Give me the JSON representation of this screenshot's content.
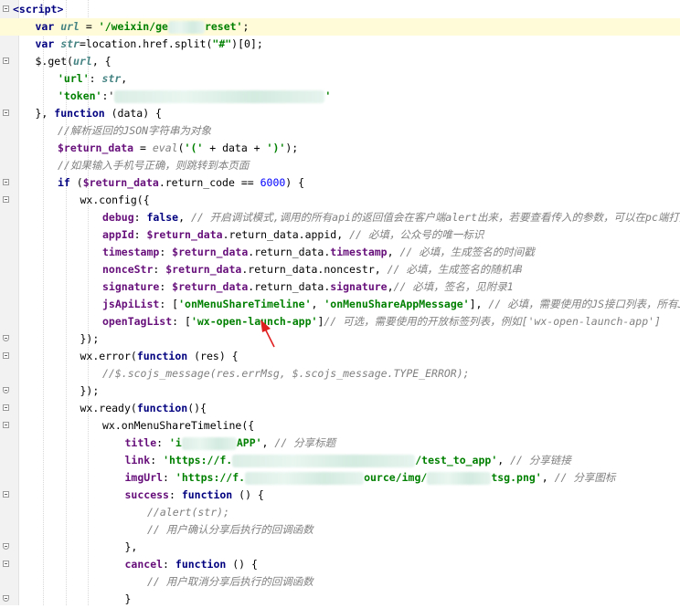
{
  "lines": [
    {
      "fold": "start",
      "hl": false,
      "indent": 0,
      "parts": [
        [
          "tag",
          "<script>"
        ]
      ]
    },
    {
      "fold": "",
      "hl": true,
      "indent": 1,
      "parts": [
        [
          "kw",
          "var "
        ],
        [
          "var",
          "url"
        ],
        [
          "plain",
          " = "
        ],
        [
          "str",
          "'/weixin/ge"
        ],
        [
          "blur",
          ""
        ],
        [
          "str",
          "reset'"
        ],
        [
          "plain",
          ";"
        ]
      ]
    },
    {
      "fold": "",
      "hl": false,
      "indent": 1,
      "parts": [
        [
          "kw",
          "var "
        ],
        [
          "var",
          "str"
        ],
        [
          "plain",
          "=location.href.split("
        ],
        [
          "str",
          "\"#\""
        ],
        [
          "plain",
          ")[0];"
        ]
      ]
    },
    {
      "fold": "start",
      "hl": false,
      "indent": 1,
      "parts": [
        [
          "plain",
          "$.get("
        ],
        [
          "var",
          "url"
        ],
        [
          "plain",
          ", {"
        ]
      ]
    },
    {
      "fold": "",
      "hl": false,
      "indent": 2,
      "parts": [
        [
          "str",
          "'url'"
        ],
        [
          "plain",
          ": "
        ],
        [
          "var",
          "str"
        ],
        [
          "plain",
          ","
        ]
      ]
    },
    {
      "fold": "",
      "hl": false,
      "indent": 2,
      "parts": [
        [
          "str",
          "'token'"
        ],
        [
          "plain",
          ":'"
        ],
        [
          "blur",
          ""
        ],
        [
          "str",
          "'"
        ]
      ]
    },
    {
      "fold": "start",
      "hl": false,
      "indent": 1,
      "parts": [
        [
          "plain",
          "}, "
        ],
        [
          "kw",
          "function "
        ],
        [
          "plain",
          "(data) {"
        ]
      ]
    },
    {
      "fold": "",
      "hl": false,
      "indent": 2,
      "parts": [
        [
          "cmt",
          "//解析返回的JSON字符串为对象"
        ]
      ]
    },
    {
      "fold": "",
      "hl": false,
      "indent": 2,
      "parts": [
        [
          "var2",
          "$return_data"
        ],
        [
          "plain",
          " = "
        ],
        [
          "cmt",
          "eval"
        ],
        [
          "plain",
          "("
        ],
        [
          "str",
          "'('"
        ],
        [
          "plain",
          " + data + "
        ],
        [
          "str",
          "')'"
        ],
        [
          "plain",
          ");"
        ]
      ]
    },
    {
      "fold": "",
      "hl": false,
      "indent": 2,
      "parts": [
        [
          "cmt",
          "//如果输入手机号正确，则跳转到本页面"
        ]
      ]
    },
    {
      "fold": "start",
      "hl": false,
      "indent": 2,
      "parts": [
        [
          "kw",
          "if "
        ],
        [
          "plain",
          "("
        ],
        [
          "var2",
          "$return_data"
        ],
        [
          "plain",
          ".return_code == "
        ],
        [
          "num",
          "6000"
        ],
        [
          "plain",
          ") {"
        ]
      ]
    },
    {
      "fold": "start",
      "hl": false,
      "indent": 3,
      "parts": [
        [
          "plain",
          "wx.config({"
        ]
      ]
    },
    {
      "fold": "",
      "hl": false,
      "indent": 4,
      "parts": [
        [
          "prop",
          "debug"
        ],
        [
          "plain",
          ": "
        ],
        [
          "kw",
          "false"
        ],
        [
          "plain",
          ", "
        ],
        [
          "cmt",
          "// 开启调试模式,调用的所有api的返回值会在客户端alert出来，若要查看传入的参数，可以在pc端打开"
        ]
      ]
    },
    {
      "fold": "",
      "hl": false,
      "indent": 4,
      "parts": [
        [
          "prop",
          "appId"
        ],
        [
          "plain",
          ": "
        ],
        [
          "var2",
          "$return_data"
        ],
        [
          "plain",
          ".return_data.appid, "
        ],
        [
          "cmt",
          "// 必填，公众号的唯一标识"
        ]
      ]
    },
    {
      "fold": "",
      "hl": false,
      "indent": 4,
      "parts": [
        [
          "prop",
          "timestamp"
        ],
        [
          "plain",
          ": "
        ],
        [
          "var2",
          "$return_data"
        ],
        [
          "plain",
          ".return_data."
        ],
        [
          "prop",
          "timestamp"
        ],
        [
          "plain",
          ", "
        ],
        [
          "cmt",
          "// 必填，生成签名的时间戳"
        ]
      ]
    },
    {
      "fold": "",
      "hl": false,
      "indent": 4,
      "parts": [
        [
          "prop",
          "nonceStr"
        ],
        [
          "plain",
          ": "
        ],
        [
          "var2",
          "$return_data"
        ],
        [
          "plain",
          ".return_data.noncestr, "
        ],
        [
          "cmt",
          "// 必填，生成签名的随机串"
        ]
      ]
    },
    {
      "fold": "",
      "hl": false,
      "indent": 4,
      "parts": [
        [
          "prop",
          "signature"
        ],
        [
          "plain",
          ": "
        ],
        [
          "var2",
          "$return_data"
        ],
        [
          "plain",
          ".return_data."
        ],
        [
          "prop",
          "signature"
        ],
        [
          "plain",
          ","
        ],
        [
          "cmt",
          "// 必填，签名，见附录1"
        ]
      ]
    },
    {
      "fold": "",
      "hl": false,
      "indent": 4,
      "parts": [
        [
          "prop",
          "jsApiList"
        ],
        [
          "plain",
          ": ["
        ],
        [
          "str",
          "'onMenuShareTimeline'"
        ],
        [
          "plain",
          ", "
        ],
        [
          "str",
          "'onMenuShareAppMessage'"
        ],
        [
          "plain",
          "], "
        ],
        [
          "cmt",
          "// 必填，需要使用的JS接口列表，所有JS"
        ]
      ]
    },
    {
      "fold": "",
      "hl": false,
      "indent": 4,
      "parts": [
        [
          "prop",
          "openTagList"
        ],
        [
          "plain",
          ": ["
        ],
        [
          "str",
          "'wx-open-launch-app'"
        ],
        [
          "plain",
          "]"
        ],
        [
          "cmt",
          "// 可选，需要使用的开放标签列表，例如['wx-open-launch-app']"
        ]
      ]
    },
    {
      "fold": "end",
      "hl": false,
      "indent": 3,
      "parts": [
        [
          "plain",
          "});"
        ]
      ]
    },
    {
      "fold": "start",
      "hl": false,
      "indent": 3,
      "parts": [
        [
          "plain",
          "wx.error("
        ],
        [
          "kw",
          "function "
        ],
        [
          "plain",
          "(res) {"
        ]
      ]
    },
    {
      "fold": "",
      "hl": false,
      "indent": 4,
      "parts": [
        [
          "cmt",
          "//$.scojs_message(res.errMsg, $.scojs_message.TYPE_ERROR);"
        ]
      ]
    },
    {
      "fold": "end",
      "hl": false,
      "indent": 3,
      "parts": [
        [
          "plain",
          "});"
        ]
      ]
    },
    {
      "fold": "start",
      "hl": false,
      "indent": 3,
      "parts": [
        [
          "plain",
          "wx.ready("
        ],
        [
          "kw",
          "function"
        ],
        [
          "plain",
          "(){"
        ]
      ]
    },
    {
      "fold": "start",
      "hl": false,
      "indent": 4,
      "parts": [
        [
          "plain",
          "wx.onMenuShareTimeline({"
        ]
      ]
    },
    {
      "fold": "",
      "hl": false,
      "indent": 5,
      "parts": [
        [
          "prop",
          "title"
        ],
        [
          "plain",
          ": "
        ],
        [
          "str",
          "'i"
        ],
        [
          "blur",
          ""
        ],
        [
          "str",
          "APP'"
        ],
        [
          "plain",
          ", "
        ],
        [
          "cmt",
          "// 分享标题"
        ]
      ]
    },
    {
      "fold": "",
      "hl": false,
      "indent": 5,
      "parts": [
        [
          "prop",
          "link"
        ],
        [
          "plain",
          ": "
        ],
        [
          "str",
          "'https://f."
        ],
        [
          "blur",
          ""
        ],
        [
          "str",
          "/test_to_app'"
        ],
        [
          "plain",
          ", "
        ],
        [
          "cmt",
          "// 分享链接"
        ]
      ]
    },
    {
      "fold": "",
      "hl": false,
      "indent": 5,
      "parts": [
        [
          "prop",
          "imgUrl"
        ],
        [
          "plain",
          ": "
        ],
        [
          "str",
          "'https://f."
        ],
        [
          "blur",
          ""
        ],
        [
          "str",
          "ource/img/"
        ],
        [
          "blur",
          ""
        ],
        [
          "str",
          "tsg.png'"
        ],
        [
          "plain",
          ", "
        ],
        [
          "cmt",
          "// 分享图标"
        ]
      ]
    },
    {
      "fold": "start",
      "hl": false,
      "indent": 5,
      "parts": [
        [
          "prop",
          "success"
        ],
        [
          "plain",
          ": "
        ],
        [
          "kw",
          "function "
        ],
        [
          "plain",
          "() {"
        ]
      ]
    },
    {
      "fold": "",
      "hl": false,
      "indent": 6,
      "parts": [
        [
          "cmt",
          "//alert(str);"
        ]
      ]
    },
    {
      "fold": "",
      "hl": false,
      "indent": 6,
      "parts": [
        [
          "cmt",
          "// 用户确认分享后执行的回调函数"
        ]
      ]
    },
    {
      "fold": "end",
      "hl": false,
      "indent": 5,
      "parts": [
        [
          "plain",
          "},"
        ]
      ]
    },
    {
      "fold": "start",
      "hl": false,
      "indent": 5,
      "parts": [
        [
          "prop",
          "cancel"
        ],
        [
          "plain",
          ": "
        ],
        [
          "kw",
          "function "
        ],
        [
          "plain",
          "() {"
        ]
      ]
    },
    {
      "fold": "",
      "hl": false,
      "indent": 6,
      "parts": [
        [
          "cmt",
          "// 用户取消分享后执行的回调函数"
        ]
      ]
    },
    {
      "fold": "end",
      "hl": false,
      "indent": 5,
      "parts": [
        [
          "plain",
          "}"
        ]
      ]
    }
  ]
}
